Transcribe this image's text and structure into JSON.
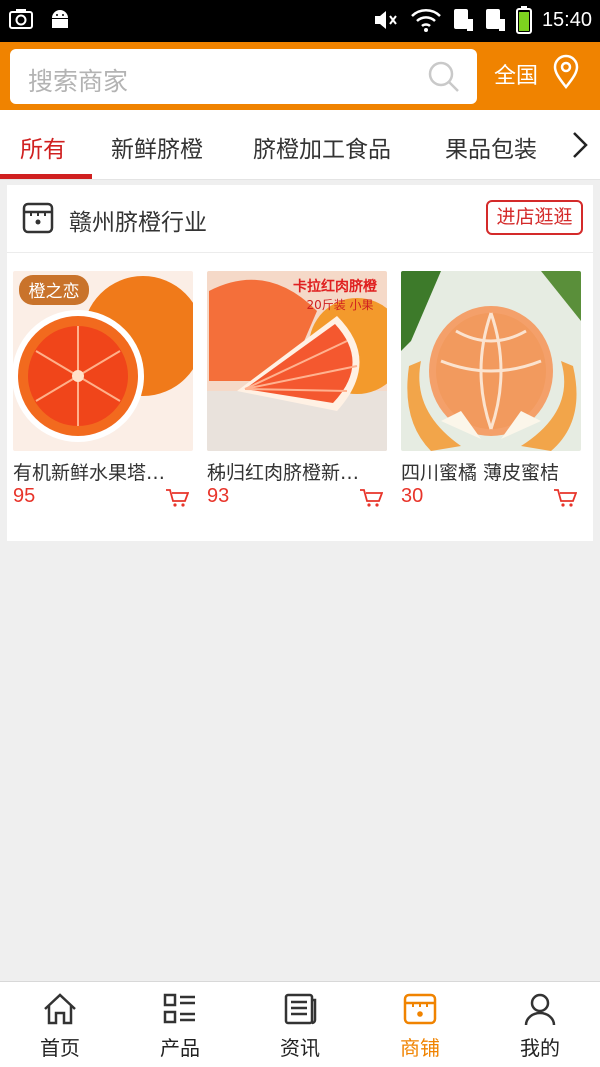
{
  "status_bar": {
    "time": "15:40"
  },
  "search": {
    "placeholder": "搜索商家",
    "region_label": "全国"
  },
  "tabs": [
    {
      "label": "所有",
      "active": true
    },
    {
      "label": "新鲜脐橙",
      "active": false
    },
    {
      "label": "脐橙加工食品",
      "active": false
    },
    {
      "label": "果品包装",
      "active": false
    }
  ],
  "store": {
    "name": "赣州脐橙行业",
    "enter_label": "进店逛逛",
    "products": [
      {
        "name": "有机新鲜水果塔…",
        "price": "95",
        "image_badge": "橙之恋"
      },
      {
        "name": "秭归红肉脐橙新…",
        "price": "93",
        "image_caption": "卡拉红肉脐橙",
        "image_caption2": "20斤装 小果"
      },
      {
        "name": "四川蜜橘 薄皮蜜桔",
        "price": "30"
      }
    ]
  },
  "bottom_nav": [
    {
      "label": "首页",
      "icon": "home-icon",
      "active": false
    },
    {
      "label": "产品",
      "icon": "list-icon",
      "active": false
    },
    {
      "label": "资讯",
      "icon": "news-icon",
      "active": false
    },
    {
      "label": "商铺",
      "icon": "shop-icon",
      "active": true
    },
    {
      "label": "我的",
      "icon": "user-icon",
      "active": false
    }
  ],
  "colors": {
    "brand": "#f08300",
    "accent_red": "#d02020",
    "price_red": "#e8342a"
  }
}
